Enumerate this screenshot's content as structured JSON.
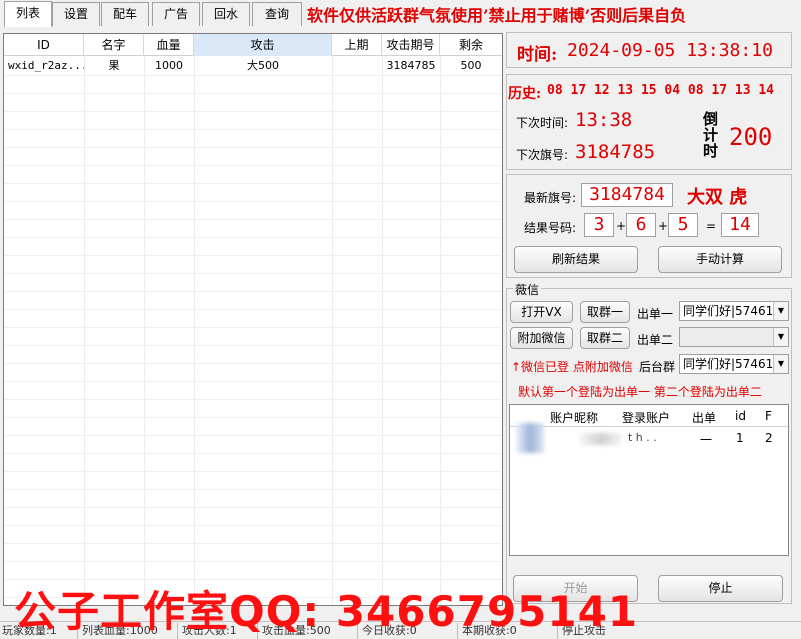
{
  "tabs": [
    "列表",
    "设置",
    "配车",
    "广告",
    "回水",
    "查询"
  ],
  "banner": "软件仅供活跃群气氛使用’禁止用于赌博’否则后果自负",
  "table": {
    "columns": [
      "ID",
      "名字",
      "血量",
      "攻击",
      "上期",
      "攻击期号",
      "剩余"
    ],
    "rows": [
      [
        "wxid_r2az...",
        "果",
        "1000",
        "大500",
        "",
        "3184785",
        "500"
      ]
    ]
  },
  "clock": {
    "label": "时间:",
    "value": "2024-09-05 13:38:10"
  },
  "history": {
    "label": "历史:",
    "values": [
      "08",
      "17",
      "12",
      "13",
      "15",
      "04",
      "08",
      "17",
      "13",
      "14"
    ]
  },
  "next": {
    "time_label": "下次时间:",
    "time_value": "13:38",
    "flag_label": "下次旗号:",
    "flag_value": "3184785",
    "countdown_label": "倒计时",
    "countdown_value": "200"
  },
  "latest": {
    "flag_label": "最新旗号:",
    "flag_value": "3184784",
    "result_text": "大双 虎",
    "result_label": "结果号码:",
    "n1": "3",
    "plus1": "+",
    "n2": "6",
    "plus2": "+",
    "n3": "5",
    "eq": "=",
    "sum": "14",
    "refresh_button": "刷新结果",
    "manual_button": "手动计算"
  },
  "wechat": {
    "group_title": "薇信",
    "open_vx_button": "打开VX",
    "get_group1_button": "取群一",
    "out1_label": "出单一",
    "out1_value": "同学们好|57461'",
    "attach_button": "附加微信",
    "get_group2_button": "取群二",
    "out2_label": "出单二",
    "out2_value": "",
    "hint_left": "↑微信已登 点附加微信",
    "backend_label": "后台群",
    "backend_value": "同学们好|57461'",
    "default_hint": "默认第一个登陆为出单一 第二个登陆为出单二",
    "accounts_columns": [
      "账户昵称",
      "登录账户",
      "出单",
      "id",
      "F"
    ],
    "accounts_rows": [
      [
        "",
        "t h . .",
        "一",
        "1",
        "2"
      ]
    ]
  },
  "start_button": "开始",
  "stop_button": "停止",
  "status": [
    "玩家数量:1",
    "列表血量:1000",
    "攻击人数:1",
    "攻击血量:500",
    "今日收获:0",
    "本期收获:0",
    "停止攻击"
  ],
  "watermark": "公子工作室QQ: 3466795141",
  "colors": {
    "accent_red": "#e00000",
    "watermark_red": "#ff0f0f",
    "header_selected": "#dbe8f7"
  }
}
